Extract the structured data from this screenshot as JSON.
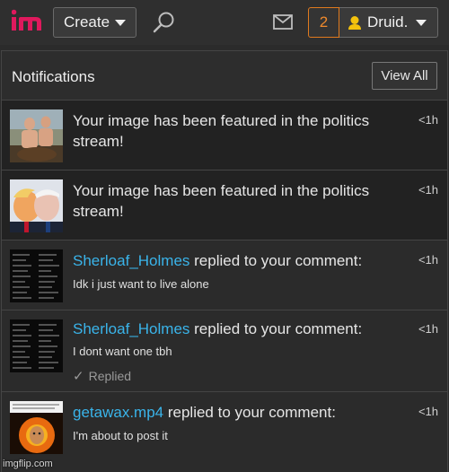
{
  "header": {
    "logo_icon": "imgflip-logo",
    "create_label": "Create",
    "search_icon": "search-icon",
    "mail_icon": "mail-icon",
    "notification_count": "2",
    "username": "Druid."
  },
  "panel": {
    "title": "Notifications",
    "view_all_label": "View All"
  },
  "notifications": [
    {
      "type": "featured",
      "message": "Your image has been featured in the politics stream!",
      "time": "<1h"
    },
    {
      "type": "featured",
      "message": "Your image has been featured in the politics stream!",
      "time": "<1h"
    },
    {
      "type": "reply",
      "user": "Sherloaf_Holmes",
      "action": " replied to your comment:",
      "comment": "Idk i just want to live alone",
      "time": "<1h"
    },
    {
      "type": "reply",
      "user": "Sherloaf_Holmes",
      "action": " replied to your comment:",
      "comment": "I dont want one tbh",
      "status": "Replied",
      "time": "<1h"
    },
    {
      "type": "reply",
      "user": "getawax.mp4",
      "action": " replied to your comment:",
      "comment": "I'm about to post it",
      "time": "<1h"
    }
  ],
  "watermark": "imgflip.com",
  "colors": {
    "accent_orange": "#e07a1e",
    "link_blue": "#3ab4ea",
    "user_yellow": "#f4c20d",
    "logo_pink": "#e0195d"
  }
}
